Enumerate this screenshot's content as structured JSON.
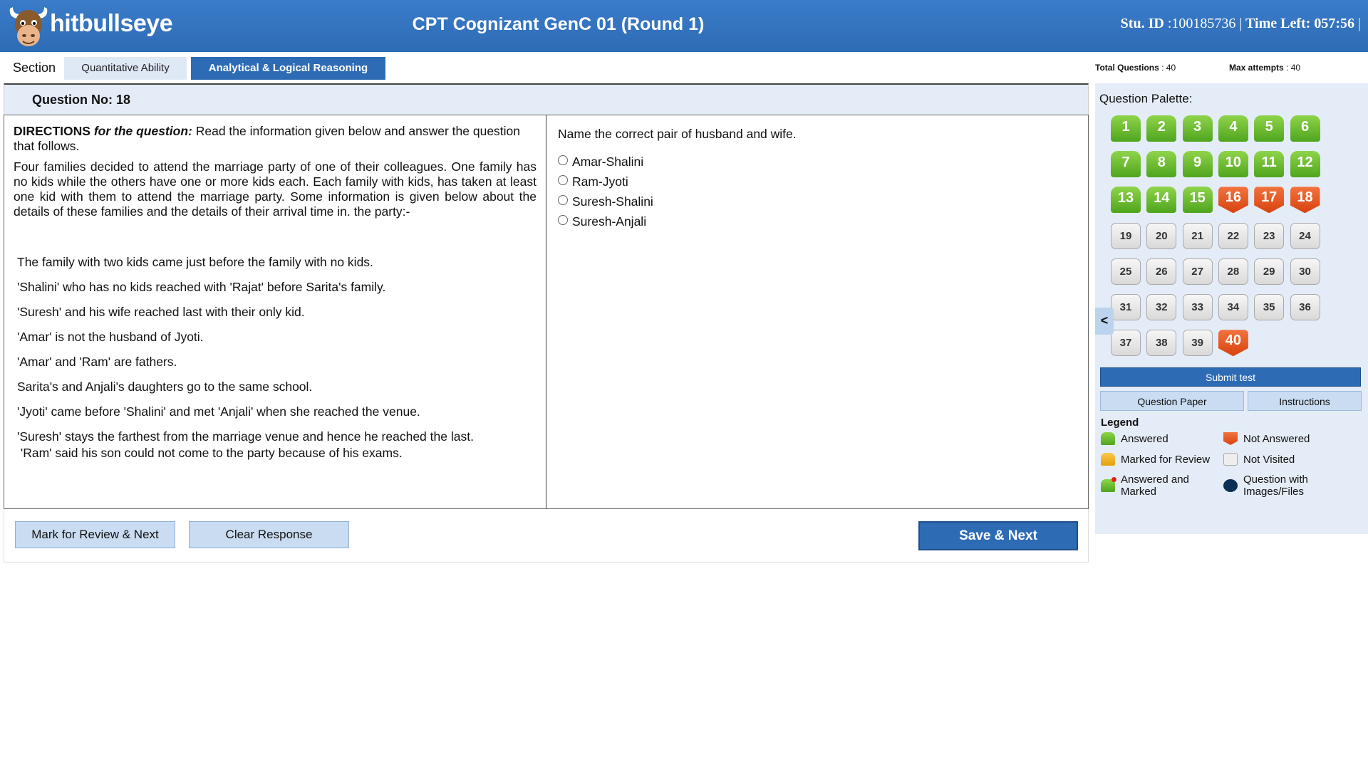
{
  "header": {
    "brand": "hitbullseye",
    "title": "CPT Cognizant GenC 01 (Round 1)",
    "stu_id_label": "Stu. ID",
    "stu_id_value": ":100185736",
    "separator1": "|",
    "time_left_label": "Time Left:",
    "time_left_value": "057:56",
    "separator2": "|"
  },
  "sections": {
    "label": "Section",
    "tabs": [
      {
        "label": "Quantitative Ability",
        "active": false
      },
      {
        "label": "Analytical & Logical Reasoning",
        "active": true
      }
    ]
  },
  "stats": {
    "total_questions_label": "Total Questions",
    "total_questions_value": ": 40",
    "max_attempts_label": "Max attempts",
    "max_attempts_value": ": 40"
  },
  "question": {
    "number_label": "Question No:",
    "number": "18",
    "directions_label": "DIRECTIONS",
    "directions_for": "for the question:",
    "directions_text": " Read the information given below and answer the question that follows.",
    "passage": "Four families decided to attend the marriage party of one of their colleagues. One family has no kids while the others have one or more kids each. Each family with kids, has taken at least one kid with them to attend the marriage party. Some information is given below about the details of these families and the details of their arrival time in. the party:-",
    "clues": [
      "The family with two kids came just before the family with no kids.",
      "'Shalini' who has no kids reached with 'Rajat' before Sarita's family.",
      "'Suresh' and his wife reached last with their only kid.",
      "'Amar' is not the husband of Jyoti.",
      "'Amar' and 'Ram' are fathers.",
      "Sarita's and Anjali's daughters go to the same school.",
      "'Jyoti' came before 'Shalini' and met 'Anjali' when she reached the venue.",
      "'Suresh' stays the farthest from the marriage venue and hence he reached the last.",
      " 'Ram' said his son could not come to the party because of his exams."
    ],
    "text": "Name the correct pair of husband and wife.",
    "options": [
      "Amar-Shalini",
      "Ram-Jyoti",
      "Suresh-Shalini",
      "Suresh-Anjali"
    ]
  },
  "buttons": {
    "mark_review": "Mark for Review & Next",
    "clear": "Clear Response",
    "save_next": "Save & Next",
    "submit": "Submit test",
    "question_paper": "Question Paper",
    "instructions": "Instructions",
    "collapse": "<"
  },
  "palette": {
    "title": "Question Palette:",
    "questions": [
      {
        "n": "1",
        "s": "answered"
      },
      {
        "n": "2",
        "s": "answered"
      },
      {
        "n": "3",
        "s": "answered"
      },
      {
        "n": "4",
        "s": "answered"
      },
      {
        "n": "5",
        "s": "answered"
      },
      {
        "n": "6",
        "s": "answered"
      },
      {
        "n": "7",
        "s": "answered"
      },
      {
        "n": "8",
        "s": "answered"
      },
      {
        "n": "9",
        "s": "answered"
      },
      {
        "n": "10",
        "s": "answered"
      },
      {
        "n": "11",
        "s": "answered"
      },
      {
        "n": "12",
        "s": "answered"
      },
      {
        "n": "13",
        "s": "answered"
      },
      {
        "n": "14",
        "s": "answered"
      },
      {
        "n": "15",
        "s": "answered"
      },
      {
        "n": "16",
        "s": "not-answered"
      },
      {
        "n": "17",
        "s": "not-answered"
      },
      {
        "n": "18",
        "s": "not-answered"
      },
      {
        "n": "19",
        "s": "not-visited"
      },
      {
        "n": "20",
        "s": "not-visited"
      },
      {
        "n": "21",
        "s": "not-visited"
      },
      {
        "n": "22",
        "s": "not-visited"
      },
      {
        "n": "23",
        "s": "not-visited"
      },
      {
        "n": "24",
        "s": "not-visited"
      },
      {
        "n": "25",
        "s": "not-visited"
      },
      {
        "n": "26",
        "s": "not-visited"
      },
      {
        "n": "27",
        "s": "not-visited"
      },
      {
        "n": "28",
        "s": "not-visited"
      },
      {
        "n": "29",
        "s": "not-visited"
      },
      {
        "n": "30",
        "s": "not-visited"
      },
      {
        "n": "31",
        "s": "not-visited"
      },
      {
        "n": "32",
        "s": "not-visited"
      },
      {
        "n": "33",
        "s": "not-visited"
      },
      {
        "n": "34",
        "s": "not-visited"
      },
      {
        "n": "35",
        "s": "not-visited"
      },
      {
        "n": "36",
        "s": "not-visited"
      },
      {
        "n": "37",
        "s": "not-visited"
      },
      {
        "n": "38",
        "s": "not-visited"
      },
      {
        "n": "39",
        "s": "not-visited"
      },
      {
        "n": "40",
        "s": "not-answered"
      }
    ]
  },
  "legend": {
    "title": "Legend",
    "answered": "Answered",
    "not_answered": "Not Answered",
    "marked_review": "Marked for Review",
    "not_visited": "Not Visited",
    "answered_marked": "Answered and Marked",
    "with_images": "Question with Images/Files"
  },
  "colors": {
    "header_blue": "#2e6bb5",
    "answered_green": "#5cb02a",
    "not_answered_red": "#e0501a",
    "review_yellow": "#f0b52a",
    "images_navy": "#0b2f55"
  }
}
